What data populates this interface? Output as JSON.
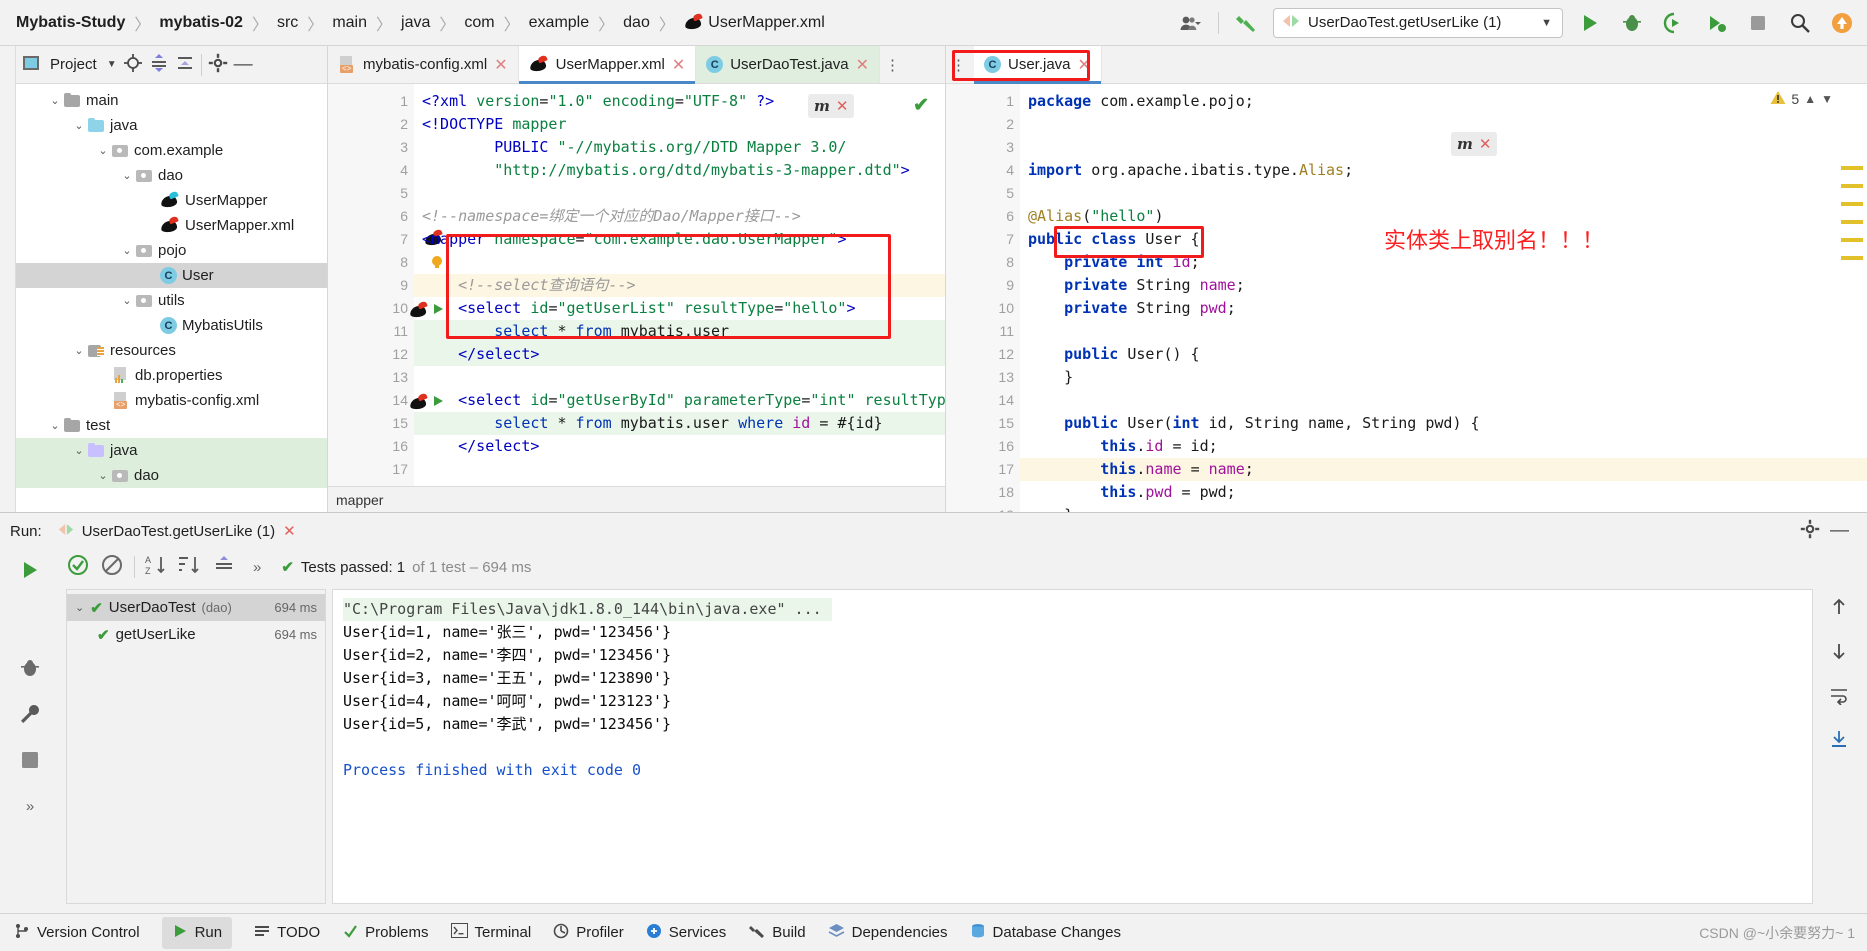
{
  "toolbar": {
    "breadcrumb": [
      {
        "label": "Mybatis-Study",
        "bold": true
      },
      {
        "label": "mybatis-02",
        "bold": true
      },
      {
        "label": "src",
        "bold": false
      },
      {
        "label": "main",
        "bold": false
      },
      {
        "label": "java",
        "bold": false
      },
      {
        "label": "com",
        "bold": false
      },
      {
        "label": "example",
        "bold": false
      },
      {
        "label": "dao",
        "bold": false
      },
      {
        "label": "UserMapper.xml",
        "bold": false
      }
    ],
    "separator": "〉",
    "people_icon": "people-icon",
    "hammer_icon": "build-hammer-icon",
    "run_config": "UserDaoTest.getUserLike (1)",
    "run_icon": "run-icon",
    "debug_icon": "debug-icon",
    "coverage_icon": "run-with-coverage-icon",
    "profile_icon": "run-with-profiler-icon",
    "stop_icon": "stop-icon",
    "search_icon": "search-icon",
    "updates_icon": "updates-available-icon"
  },
  "project_panel": {
    "title": "Project",
    "dropdown_icon": "chevron-down-icon",
    "locate_icon": "scroll-from-source-icon",
    "expand_icon": "expand-all-icon",
    "collapse_icon": "collapse-all-icon",
    "settings_icon": "gear-icon",
    "hide_icon": "hide-panel-icon",
    "tree": [
      {
        "label": "main",
        "indent": 1,
        "chev": "⌄",
        "icon": "folder",
        "selected": false
      },
      {
        "label": "java",
        "indent": 2,
        "chev": "⌄",
        "icon": "folder-blue",
        "selected": false
      },
      {
        "label": "com.example",
        "indent": 3,
        "chev": "⌄",
        "icon": "package",
        "selected": false
      },
      {
        "label": "dao",
        "indent": 4,
        "chev": "⌄",
        "icon": "package",
        "selected": false
      },
      {
        "label": "UserMapper",
        "indent": 5,
        "chev": "",
        "icon": "mybatis-teal",
        "selected": false
      },
      {
        "label": "UserMapper.xml",
        "indent": 5,
        "chev": "",
        "icon": "mybatis-red",
        "selected": false
      },
      {
        "label": "pojo",
        "indent": 4,
        "chev": "⌄",
        "icon": "package",
        "selected": false
      },
      {
        "label": "User",
        "indent": 5,
        "chev": "",
        "icon": "class",
        "selected": true
      },
      {
        "label": "utils",
        "indent": 4,
        "chev": "⌄",
        "icon": "package",
        "selected": false
      },
      {
        "label": "MybatisUtils",
        "indent": 5,
        "chev": "",
        "icon": "class",
        "selected": false
      },
      {
        "label": "resources",
        "indent": 2,
        "chev": "⌄",
        "icon": "resources",
        "selected": false
      },
      {
        "label": "db.properties",
        "indent": 3,
        "chev": "",
        "icon": "properties",
        "selected": false
      },
      {
        "label": "mybatis-config.xml",
        "indent": 3,
        "chev": "",
        "icon": "xml",
        "selected": false
      },
      {
        "label": "test",
        "indent": 1,
        "chev": "⌄",
        "icon": "folder",
        "selected": false
      },
      {
        "label": "java",
        "indent": 2,
        "chev": "⌄",
        "icon": "folder-green",
        "selected": false,
        "green": true
      },
      {
        "label": "dao",
        "indent": 3,
        "chev": "⌄",
        "icon": "package",
        "selected": false,
        "green": true
      }
    ]
  },
  "editor_left": {
    "tabs": [
      {
        "label": "mybatis-config.xml",
        "icon": "xml-file-icon",
        "active": false,
        "green": false
      },
      {
        "label": "UserMapper.xml",
        "icon": "mybatis-file-icon",
        "active": true,
        "green": false
      },
      {
        "label": "UserDaoTest.java",
        "icon": "java-class-icon",
        "active": false,
        "green": true
      }
    ],
    "kebab_icon": "more-options-icon",
    "breadcrumb_bottom": "mapper",
    "lines": [
      {
        "n": 1,
        "hl": "",
        "html": "<span class='k-tag'>&lt;?xml</span> <span class='k-attr'>version</span><span class='k-plain'>=</span><span class='k-str'>\"1.0\"</span> <span class='k-attr'>encoding</span><span class='k-plain'>=</span><span class='k-str'>\"UTF-8\"</span> <span class='k-tag'>?&gt;</span>"
      },
      {
        "n": 2,
        "hl": "",
        "html": "<span class='k-tag'>&lt;!DOCTYPE</span> <span class='k-val'>mapper</span>"
      },
      {
        "n": 3,
        "hl": "",
        "html": "        <span class='k-tag'>PUBLIC</span> <span class='k-str'>\"-//mybatis.org//DTD Mapper 3.0/</span>"
      },
      {
        "n": 4,
        "hl": "",
        "html": "        <span class='k-str'>\"http://mybatis.org/dtd/mybatis-3-mapper.dtd\"</span><span class='k-tag'>&gt;</span>"
      },
      {
        "n": 5,
        "hl": "",
        "html": ""
      },
      {
        "n": 6,
        "hl": "",
        "html": "<span class='k-cmt'>&lt;!--namespace=绑定一个对应的Dao/Mapper接口--&gt;</span>"
      },
      {
        "n": 7,
        "hl": "",
        "html": "<span class='k-tag'>&lt;mapper</span> <span class='k-attr'>namespace</span><span class='k-plain'>=</span><span class='k-str'>\"com.example.dao.UserMapper\"</span><span class='k-tag'>&gt;</span>"
      },
      {
        "n": 8,
        "hl": "",
        "html": ""
      },
      {
        "n": 9,
        "hl": "hl-yellow",
        "html": "    <span class='k-cmt'>&lt;!--select查询语句--&gt;</span>"
      },
      {
        "n": 10,
        "hl": "",
        "html": "    <span class='k-tag'>&lt;select</span> <span class='k-attr'>id</span><span class='k-plain'>=</span><span class='k-str'>\"getUserList\"</span> <span class='k-attr'>resultType</span><span class='k-plain'>=</span><span class='k-str'>\"hello\"</span><span class='k-tag'>&gt;</span>"
      },
      {
        "n": 11,
        "hl": "hl-green",
        "html": "        <span class='k-sqlkw'>select</span> <span class='k-plain'>*</span> <span class='k-sqlkw'>from</span> <span class='k-plain'>mybatis.user</span>"
      },
      {
        "n": 12,
        "hl": "hl-green",
        "html": "    <span class='k-tag'>&lt;/select&gt;</span>"
      },
      {
        "n": 13,
        "hl": "",
        "html": ""
      },
      {
        "n": 14,
        "hl": "",
        "html": "    <span class='k-tag'>&lt;select</span> <span class='k-attr'>id</span><span class='k-plain'>=</span><span class='k-str'>\"getUserById\"</span> <span class='k-attr'>parameterType</span><span class='k-plain'>=</span><span class='k-str'>\"int\"</span> <span class='k-attr'>resultType</span><span class='k-plain'>=</span><span class='k-str'>\"co</span>"
      },
      {
        "n": 15,
        "hl": "hl-green",
        "html": "        <span class='k-sqlkw'>select</span> <span class='k-plain'>*</span> <span class='k-sqlkw'>from</span> <span class='k-plain'>mybatis.user</span> <span class='k-sqlkw'>where</span> <span class='k-fld'>id</span> <span class='k-plain'>=</span> <span class='k-plain'>#{id}</span>"
      },
      {
        "n": 16,
        "hl": "",
        "html": "    <span class='k-tag'>&lt;/select&gt;</span>"
      },
      {
        "n": 17,
        "hl": "",
        "html": ""
      }
    ],
    "popup_close_icon": "close-icon",
    "popup_glyph": "mybatis-refresh-icon",
    "ok_check_icon": "inspection-ok-icon"
  },
  "editor_right": {
    "tab": {
      "label": "User.java",
      "icon": "java-class-icon"
    },
    "kebab_icon": "more-options-icon",
    "warning_count": "5",
    "warning_icon": "warning-icon",
    "up_icon": "previous-highlight-icon",
    "down_icon": "next-highlight-icon",
    "annotation_cn": "实体类上取别名！！！",
    "popup_glyph": "mybatis-refresh-icon",
    "popup_close_icon": "close-icon",
    "lines": [
      {
        "n": 1,
        "hl": "",
        "html": "<span class='k-kw'>package</span> <span class='k-plain'>com.example.pojo;</span>"
      },
      {
        "n": 2,
        "hl": "",
        "html": ""
      },
      {
        "n": 3,
        "hl": "",
        "html": ""
      },
      {
        "n": 4,
        "hl": "",
        "html": "<span class='k-kw'>import</span> <span class='k-plain'>org.apache.ibatis.type.</span><span class='k-ann'>Alias</span><span class='k-plain'>;</span>"
      },
      {
        "n": 5,
        "hl": "",
        "html": ""
      },
      {
        "n": 6,
        "hl": "",
        "html": "<span class='k-ann'>@Alias</span><span class='k-plain'>(</span><span class='k-str'>\"hello\"</span><span class='k-plain'>)</span>"
      },
      {
        "n": 7,
        "hl": "",
        "html": "<span class='k-kw'>public class</span> <span class='k-plain'>User {</span>"
      },
      {
        "n": 8,
        "hl": "",
        "html": "    <span class='k-kw'>private int</span> <span class='k-fld'>id</span><span class='k-plain'>;</span>"
      },
      {
        "n": 9,
        "hl": "",
        "html": "    <span class='k-kw'>private</span> <span class='k-plain'>String</span> <span class='k-fld'>name</span><span class='k-plain'>;</span>"
      },
      {
        "n": 10,
        "hl": "",
        "html": "    <span class='k-kw'>private</span> <span class='k-plain'>String</span> <span class='k-fld'>pwd</span><span class='k-plain'>;</span>"
      },
      {
        "n": 11,
        "hl": "",
        "html": ""
      },
      {
        "n": 12,
        "hl": "",
        "html": "    <span class='k-kw'>public</span> <span class='k-plain'>User() {</span>"
      },
      {
        "n": 13,
        "hl": "",
        "html": "    <span class='k-plain'>}</span>"
      },
      {
        "n": 14,
        "hl": "",
        "html": ""
      },
      {
        "n": 15,
        "hl": "",
        "html": "    <span class='k-kw'>public</span> <span class='k-plain'>User(</span><span class='k-kw'>int</span> <span class='k-plain'>id, String name, String pwd) {</span>"
      },
      {
        "n": 16,
        "hl": "",
        "html": "        <span class='k-kw'>this</span><span class='k-plain'>.</span><span class='k-fld'>id</span> <span class='k-plain'>= id;</span>"
      },
      {
        "n": 17,
        "hl": "hl-yellow",
        "html": "        <span class='k-kw'>this</span><span class='k-plain'>.</span><span class='k-fld'>name</span> <span class='k-plain'>= </span><span class='k-fld'>name</span><span class='k-plain'>;</span>"
      },
      {
        "n": 18,
        "hl": "",
        "html": "        <span class='k-kw'>this</span><span class='k-plain'>.</span><span class='k-fld'>pwd</span> <span class='k-plain'>= pwd;</span>"
      },
      {
        "n": 19,
        "hl": "",
        "html": "    <span class='k-plain'>}</span>"
      }
    ]
  },
  "run_panel": {
    "label": "Run:",
    "tab_title": "UserDaoTest.getUserLike (1)",
    "tab_icon": "run-config-icon",
    "close_icon": "close-icon",
    "settings_icon": "gear-icon",
    "minimize_icon": "minimize-icon",
    "toolbar_icons": [
      {
        "name": "rerun-icon"
      },
      {
        "name": "toggle-passed-icon"
      },
      {
        "name": "hide-ignored-icon"
      },
      {
        "name": "sort-alphabetically-icon"
      },
      {
        "name": "sort-by-duration-icon"
      },
      {
        "name": "expand-all-icon"
      }
    ],
    "side_icons": [
      {
        "name": "rerun-play-icon"
      },
      {
        "name": "debug-icon"
      },
      {
        "name": "wrench-icon"
      },
      {
        "name": "stop-icon"
      },
      {
        "name": "more-icon"
      }
    ],
    "expand_chevrons": "»",
    "status_check": "check-icon",
    "status_text": "Tests passed: 1",
    "status_muted": "of 1 test – 694 ms",
    "test_tree": [
      {
        "label": "UserDaoTest",
        "suffix": "(dao)",
        "time": "694 ms",
        "selected": true,
        "indent": 0
      },
      {
        "label": "getUserLike",
        "suffix": "",
        "time": "694 ms",
        "selected": false,
        "indent": 1
      }
    ],
    "console": [
      {
        "text": "\"C:\\Program Files\\Java\\jdk1.8.0_144\\bin\\java.exe\" ...",
        "style": "cmd"
      },
      {
        "text": "User{id=1, name='张三', pwd='123456'}",
        "style": ""
      },
      {
        "text": "User{id=2, name='李四', pwd='123456'}",
        "style": ""
      },
      {
        "text": "User{id=3, name='王五', pwd='123890'}",
        "style": ""
      },
      {
        "text": "User{id=4, name='呵呵', pwd='123123'}",
        "style": ""
      },
      {
        "text": "User{id=5, name='李武', pwd='123456'}",
        "style": ""
      },
      {
        "text": "",
        "style": ""
      },
      {
        "text": "Process finished with exit code 0",
        "style": "done"
      }
    ],
    "right_icons": [
      {
        "name": "scroll-up-icon"
      },
      {
        "name": "scroll-down-icon"
      },
      {
        "name": "soft-wrap-icon"
      },
      {
        "name": "scroll-to-end-icon"
      }
    ]
  },
  "status_bar": {
    "items": [
      {
        "label": "Version Control",
        "icon": "branch-icon",
        "active": false
      },
      {
        "label": "Run",
        "icon": "run-icon",
        "active": true
      },
      {
        "label": "TODO",
        "icon": "todo-icon",
        "active": false
      },
      {
        "label": "Problems",
        "icon": "problems-icon",
        "active": false
      },
      {
        "label": "Terminal",
        "icon": "terminal-icon",
        "active": false
      },
      {
        "label": "Profiler",
        "icon": "profiler-icon",
        "active": false
      },
      {
        "label": "Services",
        "icon": "services-icon",
        "active": false
      },
      {
        "label": "Build",
        "icon": "build-icon",
        "active": false
      },
      {
        "label": "Dependencies",
        "icon": "dependencies-icon",
        "active": false
      },
      {
        "label": "Database Changes",
        "icon": "database-icon",
        "active": false
      }
    ],
    "watermark": "CSDN @~小余要努力~ 1"
  },
  "colors": {
    "accent_blue": "#4a88c7",
    "annotation_red": "#f21b1b",
    "pass_green": "#3c9c3c",
    "selection_gray": "#d4d4d4"
  }
}
